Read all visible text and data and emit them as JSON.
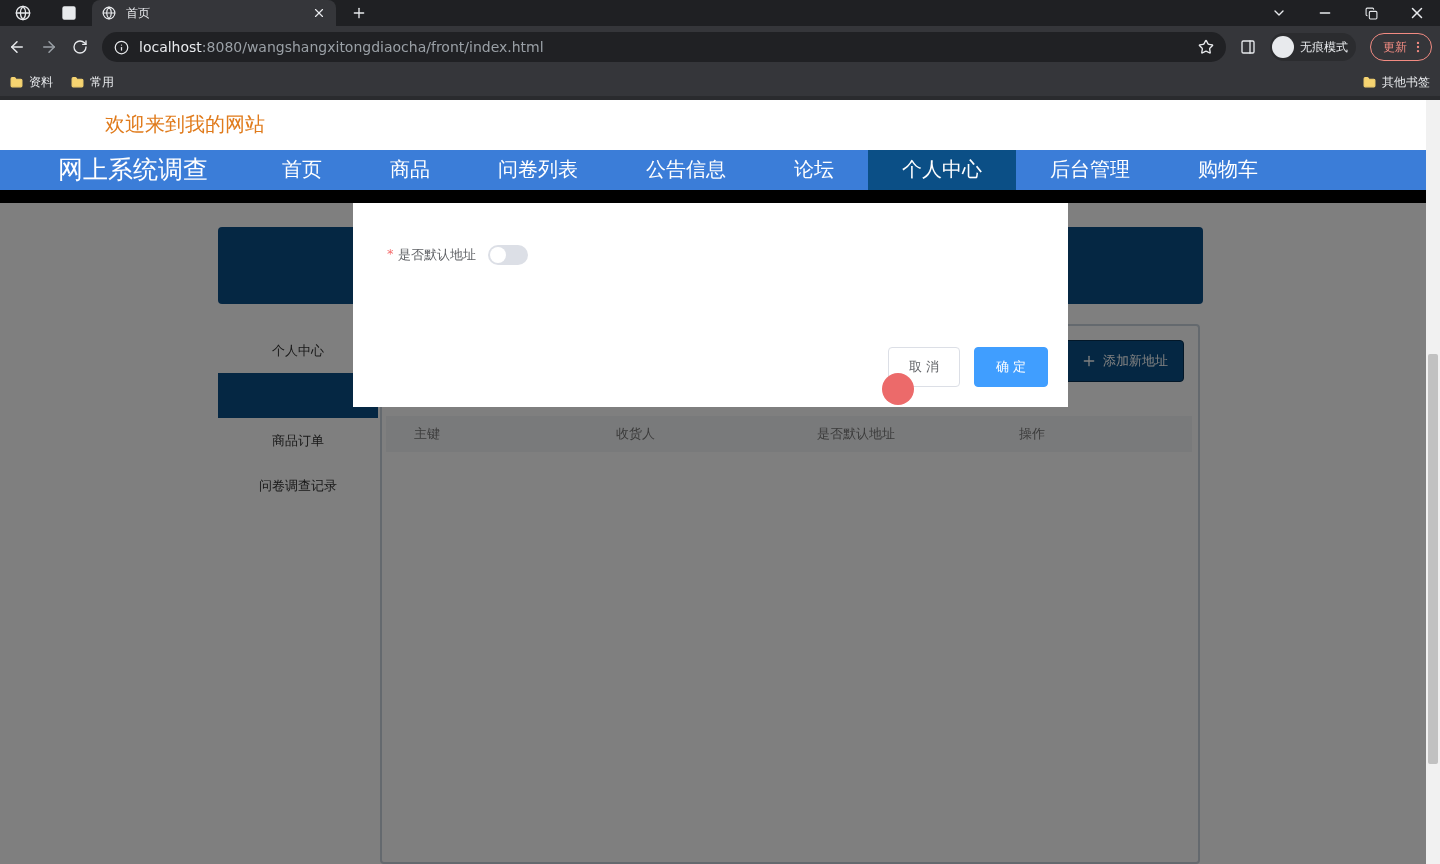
{
  "browser": {
    "tabs": [
      {
        "title": "首页",
        "selected": true
      }
    ],
    "url_host": "localhost",
    "url_path": ":8080/wangshangxitongdiaocha/front/index.html",
    "profile_label": "无痕模式",
    "update_button": "更新",
    "bookmarks": [
      "资料",
      "常用"
    ],
    "other_bookmarks": "其他书签"
  },
  "header": {
    "welcome": "欢迎来到我的网站"
  },
  "nav": {
    "brand": "网上系统调查",
    "items": [
      {
        "label": "首页",
        "selected": false
      },
      {
        "label": "商品",
        "selected": false
      },
      {
        "label": "问卷列表",
        "selected": false
      },
      {
        "label": "公告信息",
        "selected": false
      },
      {
        "label": "论坛",
        "selected": false
      },
      {
        "label": "个人中心",
        "selected": true
      },
      {
        "label": "后台管理",
        "selected": false
      },
      {
        "label": "购物车",
        "selected": false
      }
    ]
  },
  "sidebar": {
    "items": [
      {
        "label": "个人中心",
        "selected": false
      },
      {
        "selected": true
      },
      {
        "label": "商品订单",
        "selected": false
      },
      {
        "label": "问卷调查记录",
        "selected": false
      }
    ]
  },
  "content": {
    "add_button": "添加新地址",
    "table": {
      "columns": [
        "主键",
        "收货人",
        "是否默认地址",
        "操作"
      ]
    }
  },
  "dialog": {
    "field": {
      "label": "是否默认地址",
      "required_mark": "*",
      "on": false
    },
    "buttons": [
      {
        "label": "取 消",
        "kind": "default"
      },
      {
        "label": "确 定",
        "kind": "primary"
      }
    ]
  }
}
